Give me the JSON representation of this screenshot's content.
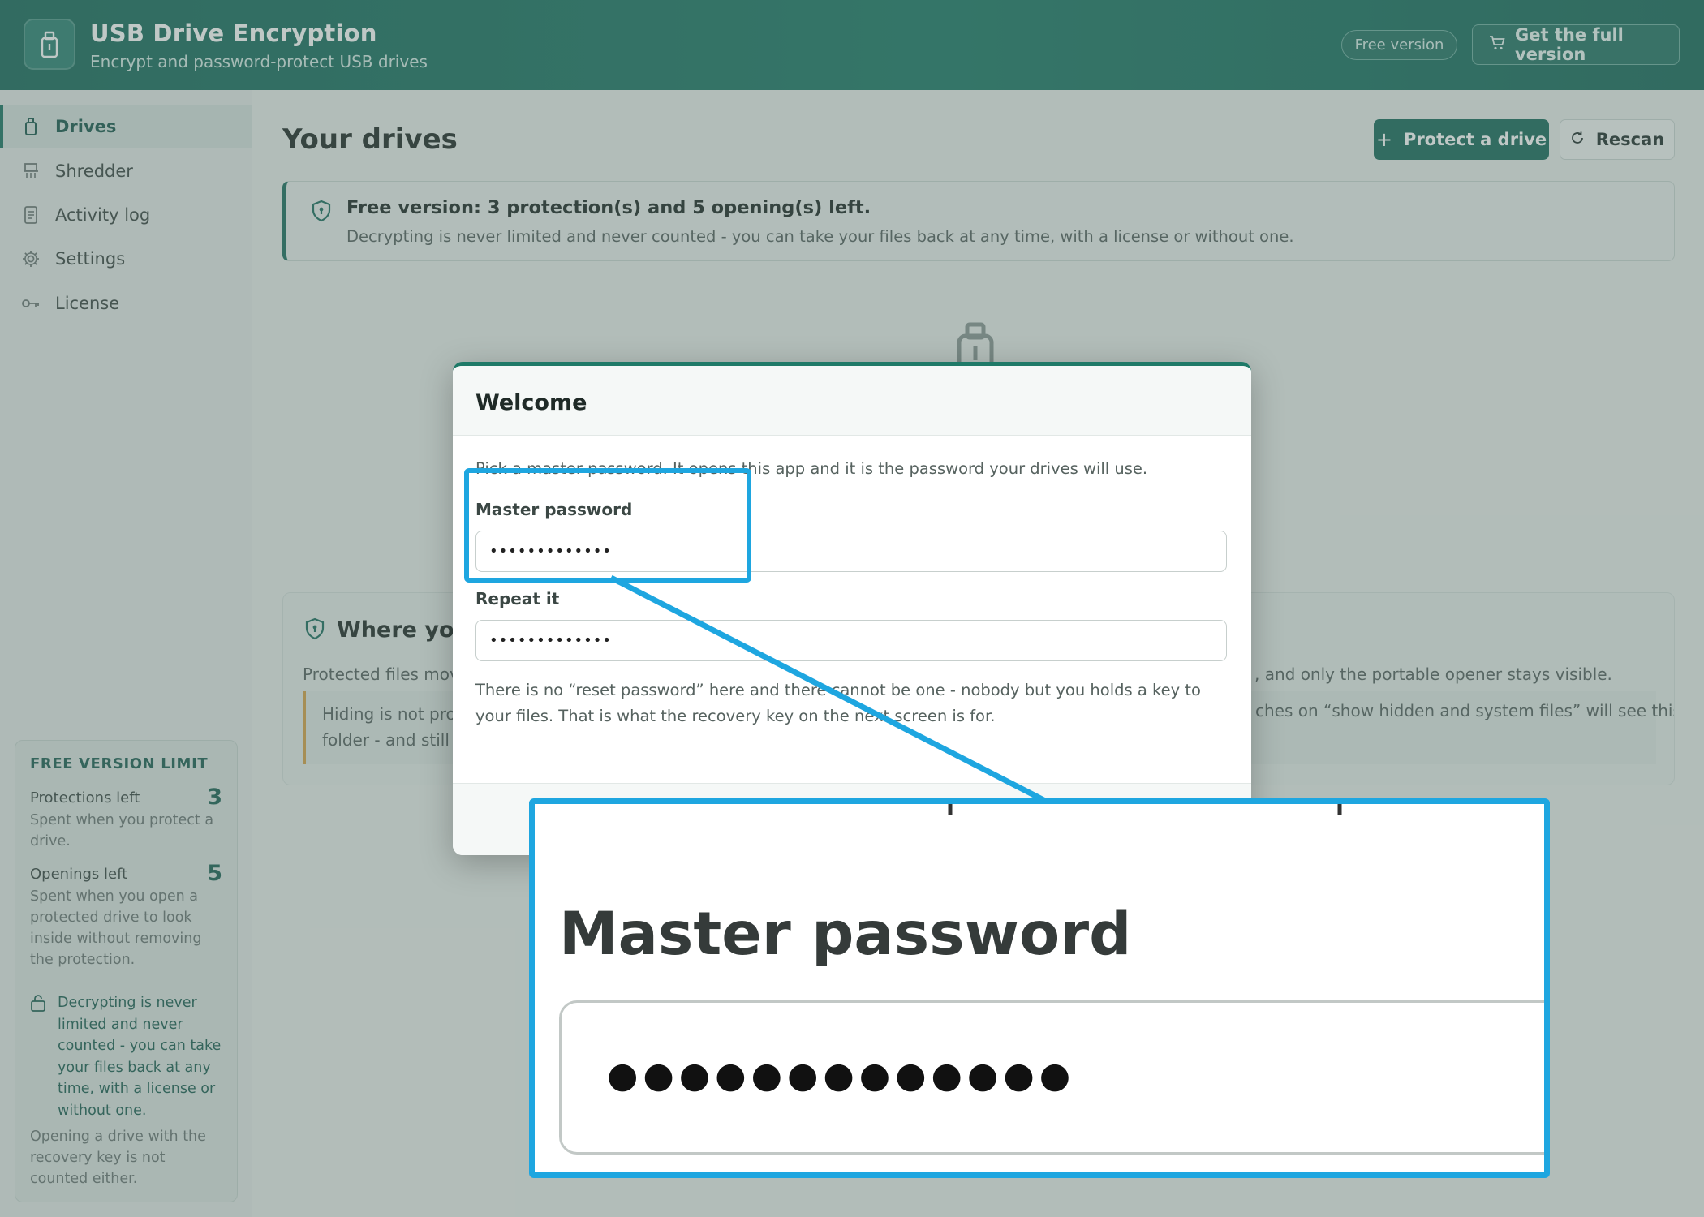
{
  "app": {
    "title": "USB Drive Encryption",
    "subtitle": "Encrypt and password-protect USB drives",
    "free_badge": "Free version",
    "full_version_label": "Get the full version",
    "accent": "#1b6b5d"
  },
  "sidebar": {
    "items": [
      {
        "label": "Drives",
        "icon": "usb-drive-icon",
        "active": true
      },
      {
        "label": "Shredder",
        "icon": "shredder-icon",
        "active": false
      },
      {
        "label": "Activity log",
        "icon": "log-icon",
        "active": false
      },
      {
        "label": "Settings",
        "icon": "gear-icon",
        "active": false
      },
      {
        "label": "License",
        "icon": "key-icon",
        "active": false
      }
    ],
    "limit": {
      "title": "FREE VERSION LIMIT",
      "protections_label": "Protections left",
      "protections_value": "3",
      "protections_desc": "Spent when you protect a drive.",
      "openings_label": "Openings left",
      "openings_value": "5",
      "openings_desc": "Spent when you open a protected drive to look inside without removing the protection.",
      "decrypt_note": "Decrypting is never limited and never counted - you can take your files back at any time, with a license or without one.",
      "recovery_note": "Opening a drive with the recovery key is not counted either."
    }
  },
  "main": {
    "title": "Your drives",
    "protect_label": "Protect a drive",
    "rescan_label": "Rescan",
    "notice_title": "Free version: 3 protection(s) and 5 opening(s) left.",
    "notice_text": "Decrypting is never limited and never counted - you can take your files back at any time, with a license or without one.",
    "where_title": "Where your",
    "where_text_left": "Protected files move",
    "where_text_right": ", and only the portable opener stays visible.",
    "hide_left_1": "Hiding is not prot",
    "hide_left_2": "folder - and still w",
    "hide_right": "ches on “show hidden and system files” will see this"
  },
  "modal": {
    "title": "Welcome",
    "intro": "Pick a master password. It opens this app and it is the password your drives will use.",
    "master_label": "Master password",
    "master_value": "•••••••••••••",
    "repeat_label": "Repeat it",
    "repeat_value": "•••••••••••••",
    "warning": "There is no “reset password” here and there cannot be one - nobody but you holds a key to your files. That is what the recovery key on the next screen is for."
  },
  "zoom": {
    "label": "Master password",
    "dots": "●●●●●●●●●●●●●",
    "callout_color": "#1ea6e0"
  }
}
